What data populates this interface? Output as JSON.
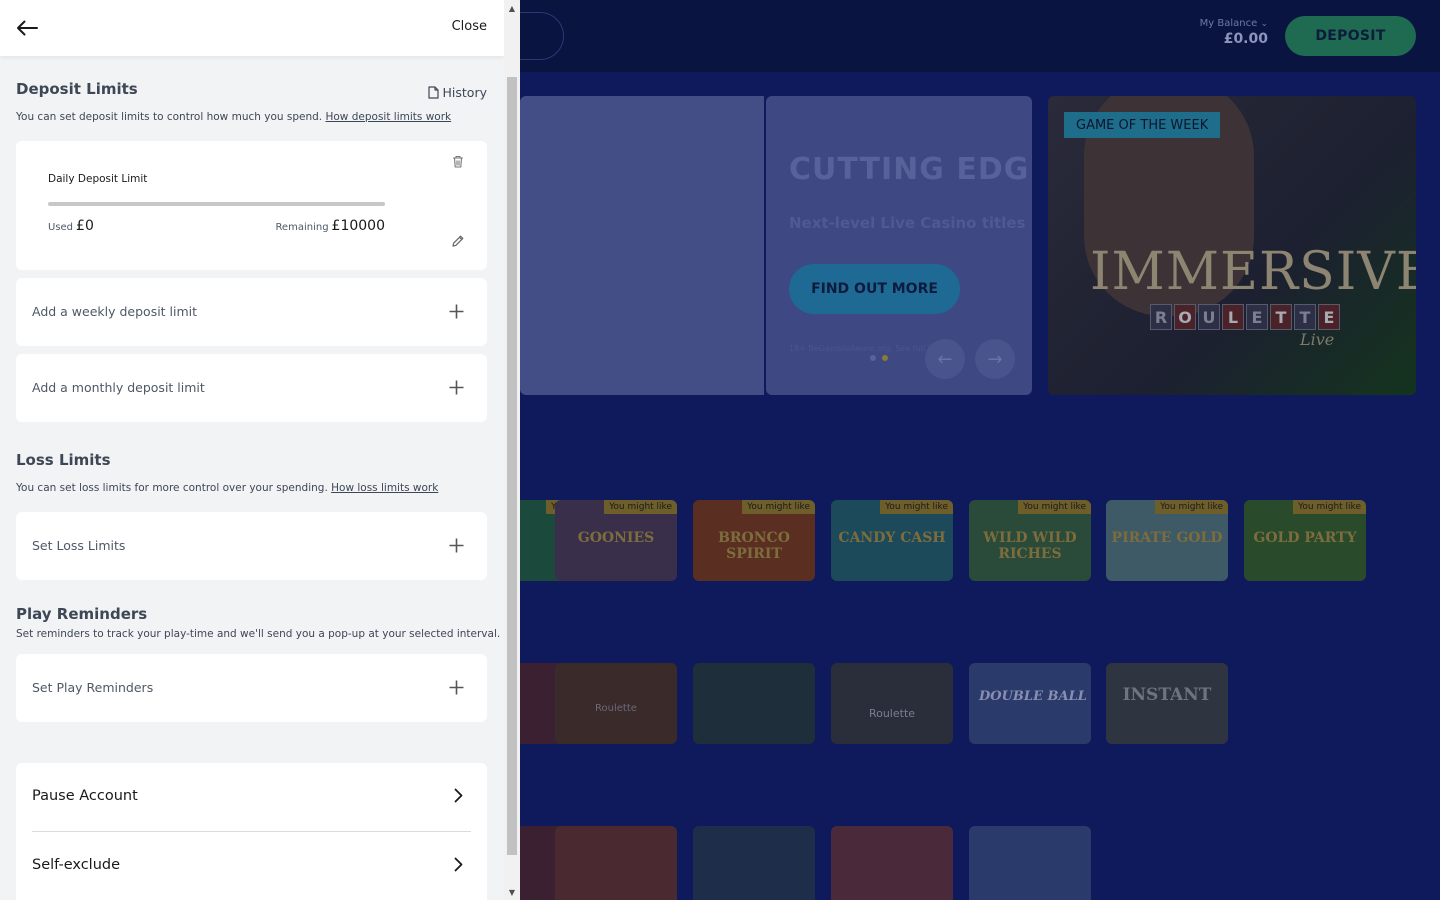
{
  "background": {
    "balance_label": "My Balance",
    "balance_value": "£0.00",
    "deposit_label": "DEPOSIT",
    "hero": {
      "title": "CUTTING EDGE",
      "subtitle": "Next-level Live Casino titles",
      "cta": "FIND OUT MORE",
      "fine_print": "18+ BeGambleAware.org. See full T&Cs"
    },
    "featured": {
      "badge": "GAME OF THE WEEK",
      "title": "IMMERSIVE",
      "letters": [
        "R",
        "O",
        "U",
        "L",
        "E",
        "T",
        "T",
        "E"
      ],
      "subtitle": "Live"
    },
    "tile_tag": "You might like",
    "row1_tiles": [
      "GOONIES",
      "BRONCO SPIRIT",
      "CANDY CASH",
      "WILD WILD RICHES",
      "PIRATE GOLD",
      "GOLD PARTY"
    ],
    "row2_tiles": [
      "Roulette",
      "Roulette",
      "Roulette",
      "DOUBLE BALL",
      "INSTANT"
    ],
    "row3_tiles": [
      "",
      "",
      "",
      "",
      ""
    ]
  },
  "drawer": {
    "close_label": "Close",
    "deposit_limits": {
      "title": "Deposit Limits",
      "history_label": "History",
      "description": "You can set deposit limits to control how much you spend.",
      "link": "How deposit limits work",
      "daily": {
        "title": "Daily Deposit Limit",
        "used_label": "Used",
        "used_value": "£0",
        "remaining_label": "Remaining",
        "remaining_value": "£10000",
        "used_fraction": 0
      },
      "weekly_label": "Add a weekly deposit limit",
      "monthly_label": "Add a monthly deposit limit"
    },
    "loss_limits": {
      "title": "Loss Limits",
      "description": "You can set loss limits for more control over your spending.",
      "link": "How loss limits work",
      "set_label": "Set Loss Limits"
    },
    "play_reminders": {
      "title": "Play Reminders",
      "description": "Set reminders to track your play-time and we'll send you a pop-up at your selected interval.",
      "set_label": "Set Play Reminders"
    },
    "account": {
      "pause_label": "Pause Account",
      "exclude_label": "Self-exclude"
    }
  }
}
